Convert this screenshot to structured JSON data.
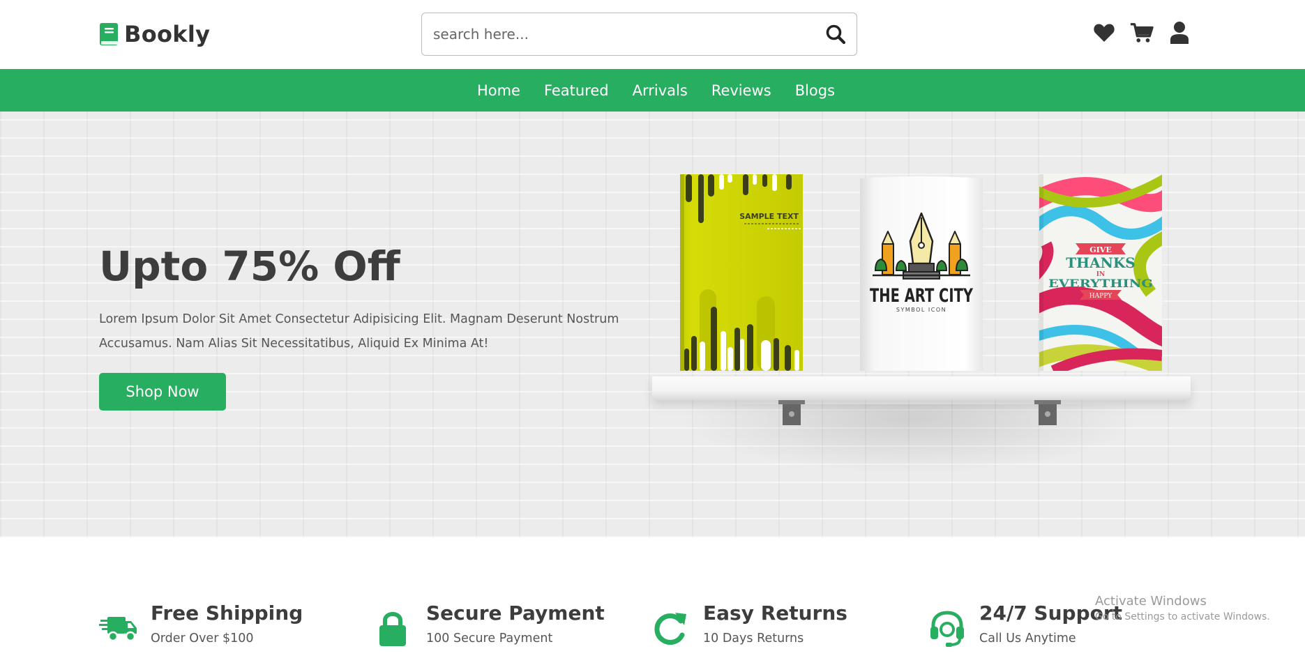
{
  "brand": {
    "name": "Bookly"
  },
  "search": {
    "placeholder": "search here..."
  },
  "header_icons": [
    "heart-icon",
    "cart-icon",
    "user-icon"
  ],
  "nav": {
    "items": [
      {
        "label": "Home"
      },
      {
        "label": "Featured"
      },
      {
        "label": "Arrivals"
      },
      {
        "label": "Reviews"
      },
      {
        "label": "Blogs"
      }
    ]
  },
  "hero": {
    "title": "Upto 75% Off",
    "description": "Lorem Ipsum Dolor Sit Amet Consectetur Adipisicing Elit. Magnam Deserunt Nostrum Accusamus. Nam Alias Sit Necessitatibus, Aliquid Ex Minima At!",
    "cta_label": "Shop Now",
    "books": [
      {
        "cover_text": "SAMPLE TEXT"
      },
      {
        "cover_title": "THE ART CITY",
        "cover_subtitle": "SYMBOL ICON"
      },
      {
        "cover_lines": [
          "GIVE",
          "THANKS",
          "IN",
          "EVERYTHING",
          "HAPPY"
        ]
      }
    ]
  },
  "features": [
    {
      "icon": "truck-icon",
      "title": "Free Shipping",
      "subtitle": "Order Over $100"
    },
    {
      "icon": "lock-icon",
      "title": "Secure Payment",
      "subtitle": "100 Secure Payment"
    },
    {
      "icon": "redo-icon",
      "title": "Easy Returns",
      "subtitle": "10 Days Returns"
    },
    {
      "icon": "headset-icon",
      "title": "24/7 Support",
      "subtitle": "Call Us Anytime"
    }
  ],
  "watermark": {
    "line1": "Activate Windows",
    "line2": "Go to Settings to activate Windows."
  },
  "colors": {
    "brand_green": "#27ae60",
    "text_dark": "#3d3d3d",
    "text_muted": "#555555"
  }
}
